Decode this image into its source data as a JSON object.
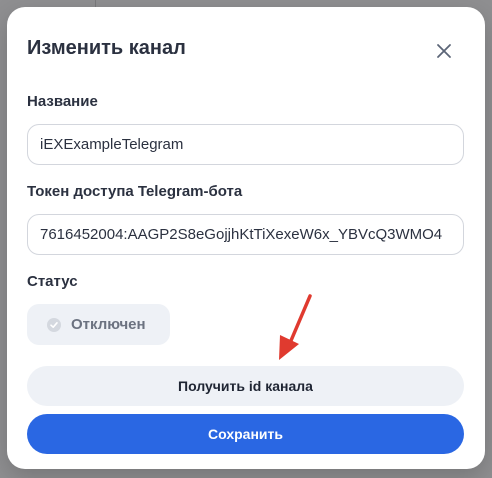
{
  "modal": {
    "title": "Изменить канал",
    "close_icon": "close-icon"
  },
  "form": {
    "name_label": "Название",
    "name_value": "iEXExampleTelegram",
    "token_label": "Токен доступа Telegram-бота",
    "token_value": "7616452004:AAGP2S8eGojjhKtTiXexeW6x_YBVcQ3WMO4",
    "status_label": "Статус",
    "status_value": "Отключен",
    "status_icon": "check-circle-icon"
  },
  "actions": {
    "get_id_label": "Получить id канала",
    "save_label": "Сохранить"
  },
  "colors": {
    "primary": "#2a67e3",
    "annotation_arrow": "#e03a2f"
  }
}
